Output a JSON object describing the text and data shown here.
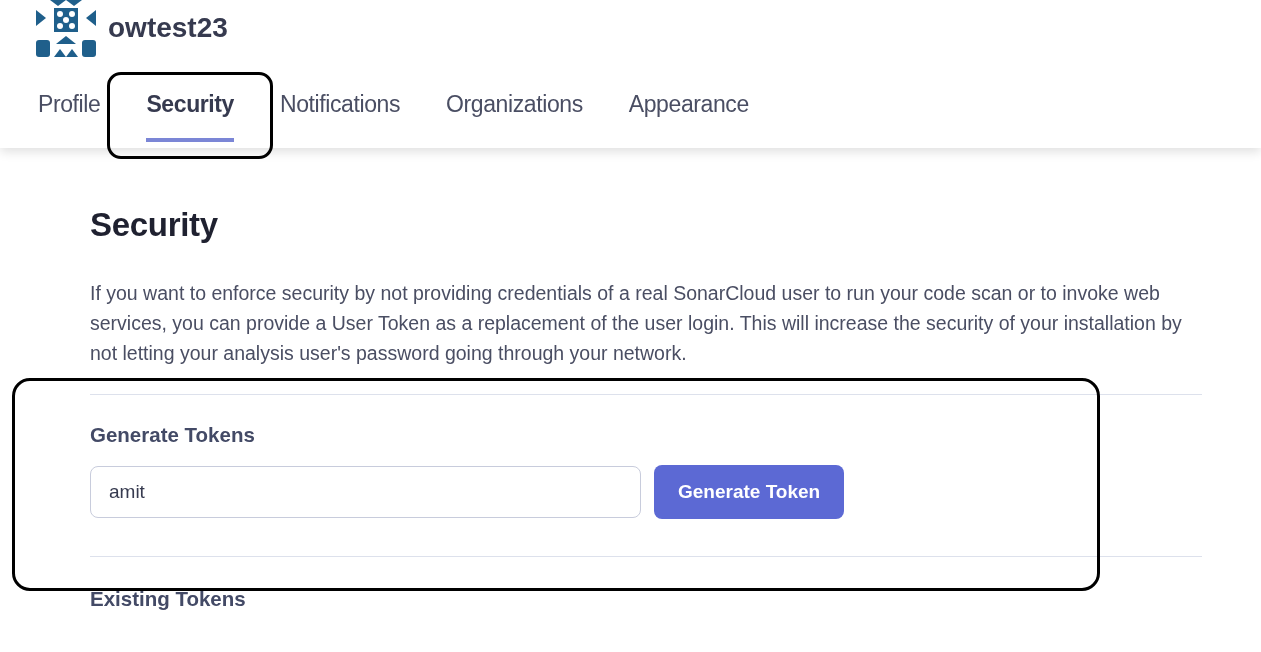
{
  "header": {
    "username": "owtest23"
  },
  "tabs": [
    {
      "label": "Profile",
      "selected": false
    },
    {
      "label": "Security",
      "selected": true
    },
    {
      "label": "Notifications",
      "selected": false
    },
    {
      "label": "Organizations",
      "selected": false
    },
    {
      "label": "Appearance",
      "selected": false
    }
  ],
  "page": {
    "title": "Security",
    "description": "If you want to enforce security by not providing credentials of a real SonarCloud user to run your code scan or to invoke web services, you can provide a User Token as a replacement of the user login. This will increase the security of your installation by not letting your analysis user's password going through your network."
  },
  "generate": {
    "heading": "Generate Tokens",
    "token_name": "amit",
    "button": "Generate Token"
  },
  "existing": {
    "heading": "Existing Tokens"
  }
}
